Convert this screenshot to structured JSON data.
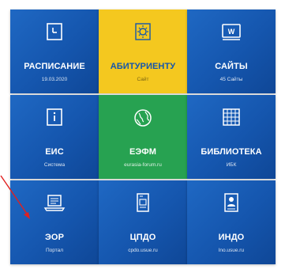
{
  "colors": {
    "tile_blue": "#1a5fb8",
    "tile_yellow": "#f4c81f",
    "tile_green": "#27a251",
    "arrow": "#e02020"
  },
  "tiles": [
    {
      "title": "РАСПИСАНИЕ",
      "subtitle": "19.03.2020",
      "icon": "calendar-icon"
    },
    {
      "title": "АБИТУРИЕНТУ",
      "subtitle": "Сайт",
      "icon": "sun-icon"
    },
    {
      "title": "САЙТЫ",
      "subtitle": "45 Сайты",
      "icon": "w-icon"
    },
    {
      "title": "ЕИС",
      "subtitle": "Система",
      "icon": "info-icon"
    },
    {
      "title": "ЕЭФМ",
      "subtitle": "eurasia-forum.ru",
      "icon": "globe-icon"
    },
    {
      "title": "БИБЛИОТЕКА",
      "subtitle": "ИБК",
      "icon": "grid-icon"
    },
    {
      "title": "ЭОР",
      "subtitle": "Портал",
      "icon": "laptop-icon"
    },
    {
      "title": "ЦПДО",
      "subtitle": "cpdo.usue.ru",
      "icon": "document-icon"
    },
    {
      "title": "ИНДО",
      "subtitle": "lno.usue.ru",
      "icon": "id-card-icon"
    }
  ]
}
